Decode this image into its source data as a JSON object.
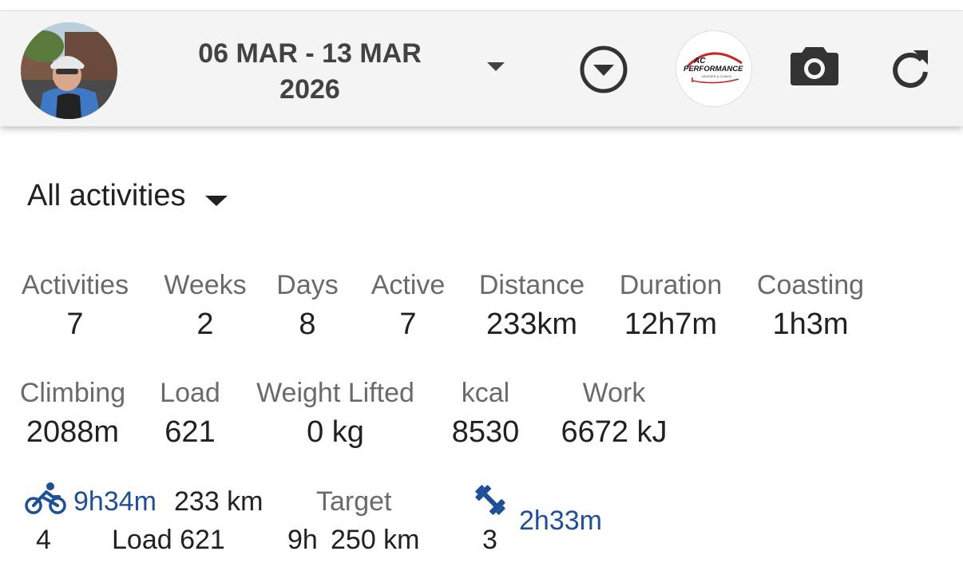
{
  "header": {
    "date_line1": "06 MAR - 13 MAR",
    "date_line2": "2026",
    "logo": {
      "line1": "AC",
      "line2": "PERFORMANCE",
      "line3": "ADVISER & COACH"
    }
  },
  "filter": {
    "label": "All activities"
  },
  "stats_row1": [
    {
      "label": "Activities",
      "value": "7"
    },
    {
      "label": "Weeks",
      "value": "2"
    },
    {
      "label": "Days",
      "value": "8"
    },
    {
      "label": "Active",
      "value": "7"
    },
    {
      "label": "Distance",
      "value": "233km"
    },
    {
      "label": "Duration",
      "value": "12h7m"
    },
    {
      "label": "Coasting",
      "value": "1h3m"
    }
  ],
  "stats_row2": [
    {
      "label": "Climbing",
      "value": "2088m"
    },
    {
      "label": "Load",
      "value": "621"
    },
    {
      "label": "Weight Lifted",
      "value": "0 kg"
    },
    {
      "label": "kcal",
      "value": "8530"
    },
    {
      "label": "Work",
      "value": "6672 kJ"
    }
  ],
  "summary": {
    "ride": {
      "count": "4",
      "duration": "9h34m",
      "distance": "233 km",
      "load": "Load 621"
    },
    "target": {
      "label": "Target",
      "duration": "9h",
      "distance": "250 km"
    },
    "strength": {
      "count": "3",
      "duration": "2h33m"
    }
  },
  "colors": {
    "accent_blue": "#1f4f96",
    "header_bg": "#f4f4f4",
    "icon_dark": "#333333"
  },
  "icons": [
    "avatar",
    "chevron-down-icon",
    "circle-dropdown-icon",
    "camera-icon",
    "refresh-icon",
    "bike-icon",
    "dumbbell-icon"
  ]
}
